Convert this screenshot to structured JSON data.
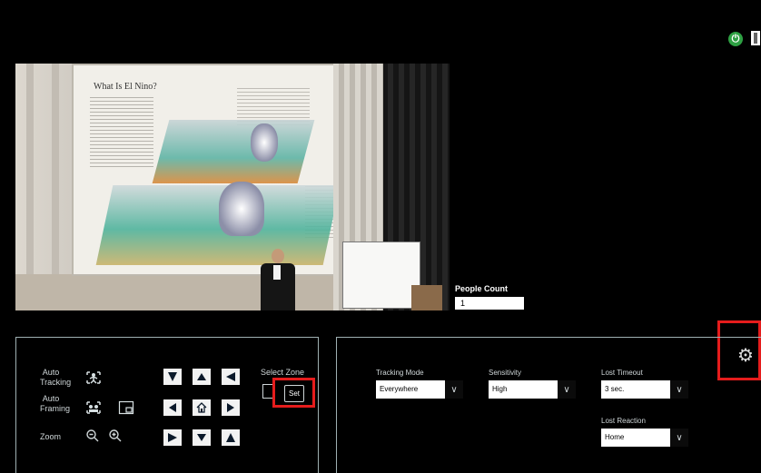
{
  "header": {
    "power_icon": "power-icon",
    "exit_icon": "exit-door-icon"
  },
  "video": {
    "slide_title": "What Is El Nino?"
  },
  "people_count": {
    "label": "People Count",
    "value": "1"
  },
  "controls": {
    "auto_tracking_label": "Auto Tracking",
    "auto_framing_label": "Auto Framing",
    "zoom_label": "Zoom",
    "select_zone_label": "Select Zone",
    "set_button_label": "Set"
  },
  "settings": {
    "tracking_mode": {
      "label": "Tracking Mode",
      "value": "Everywhere"
    },
    "sensitivity": {
      "label": "Sensitivity",
      "value": "High"
    },
    "lost_timeout": {
      "label": "Lost Timeout",
      "value": "3 sec."
    },
    "lost_reaction": {
      "label": "Lost Reaction",
      "value": "Home"
    }
  },
  "colors": {
    "highlight": "#e51c1c",
    "power": "#2ea043",
    "panel_border": "#9fb0b2"
  }
}
